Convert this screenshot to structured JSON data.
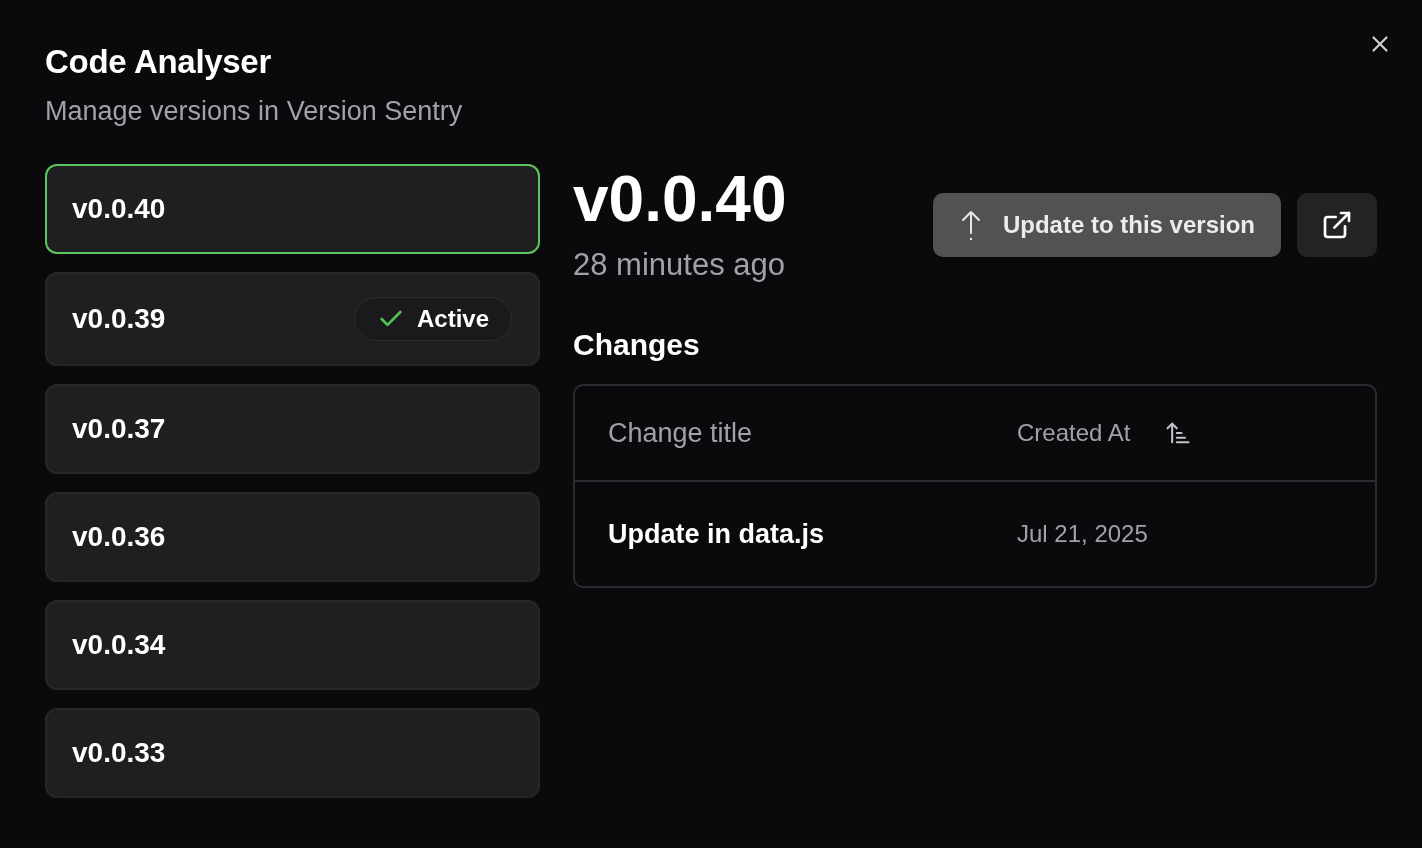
{
  "dialog": {
    "title": "Code Analyser",
    "subtitle": "Manage versions in Version Sentry"
  },
  "versions": [
    {
      "label": "v0.0.40",
      "selected": true
    },
    {
      "label": "v0.0.39",
      "selected": false,
      "badge": "Active"
    },
    {
      "label": "v0.0.37",
      "selected": false
    },
    {
      "label": "v0.0.36",
      "selected": false
    },
    {
      "label": "v0.0.34",
      "selected": false
    },
    {
      "label": "v0.0.33",
      "selected": false
    }
  ],
  "detail": {
    "version": "v0.0.40",
    "time": "28 minutes ago",
    "update_button": "Update to this version"
  },
  "changes": {
    "heading": "Changes",
    "columns": [
      {
        "label": "Change title",
        "sorted": false
      },
      {
        "label": "Created At",
        "sorted": true
      }
    ],
    "rows": [
      {
        "title": "Update in data.js",
        "created_at": "Jul 21, 2025"
      }
    ]
  }
}
